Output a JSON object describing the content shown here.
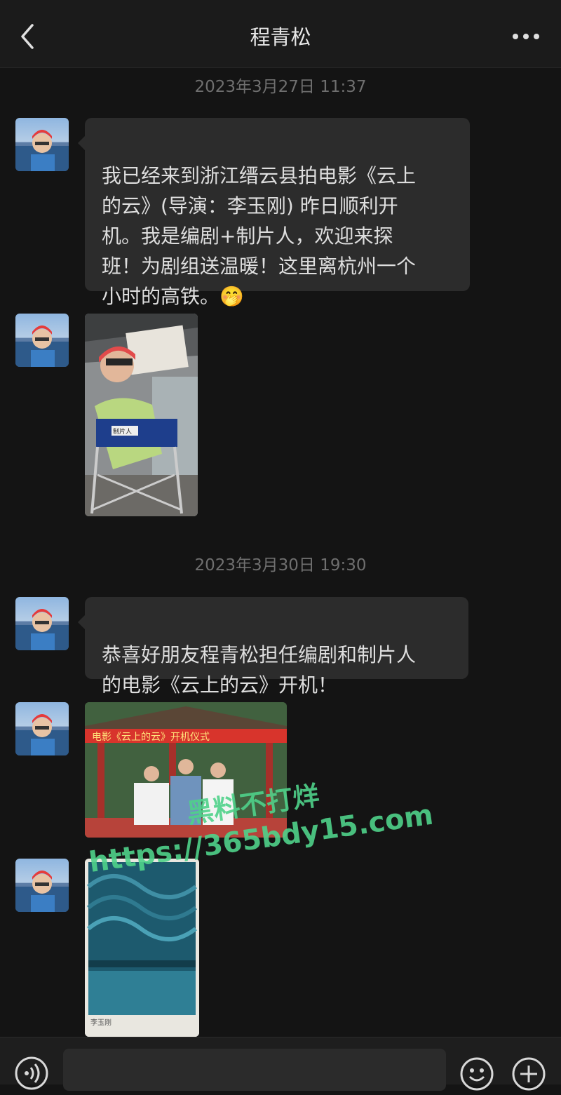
{
  "header": {
    "title": "程青松",
    "back_icon": "chevron-left-icon",
    "more_icon": "ellipsis-icon"
  },
  "messages": {
    "timestamp_1": "2023年3月27日 11:37",
    "msg_1_text": "我已经来到浙江缙云县拍电影《云上\n的云》(导演：李玉刚) 昨日顺利开\n机。我是编剧+制片人，欢迎来探\n班！为剧组送温暖！这里离杭州一个\n小时的高铁。",
    "msg_1_emoji": "🤭",
    "photo_1_sign": "制片人",
    "timestamp_2": "2023年3月30日 19:30",
    "msg_3_text": "恭喜好朋友程青松担任编剧和制片人\n的电影《云上的云》开机！",
    "photo_2_banner": "电影《云上的云》开机仪式",
    "photo_3_caption": "李玉刚"
  },
  "watermark": {
    "line1": "黑料不打烊",
    "line2": "https://365bdy15.com"
  },
  "input_bar": {
    "voice_icon": "voice-icon",
    "emoji_icon": "emoji-icon",
    "plus_icon": "plus-icon",
    "placeholder": ""
  },
  "colors": {
    "background": "#141414",
    "bubble": "#2c2c2c",
    "header": "#1b1b1b",
    "watermark": "#4fd28a"
  }
}
